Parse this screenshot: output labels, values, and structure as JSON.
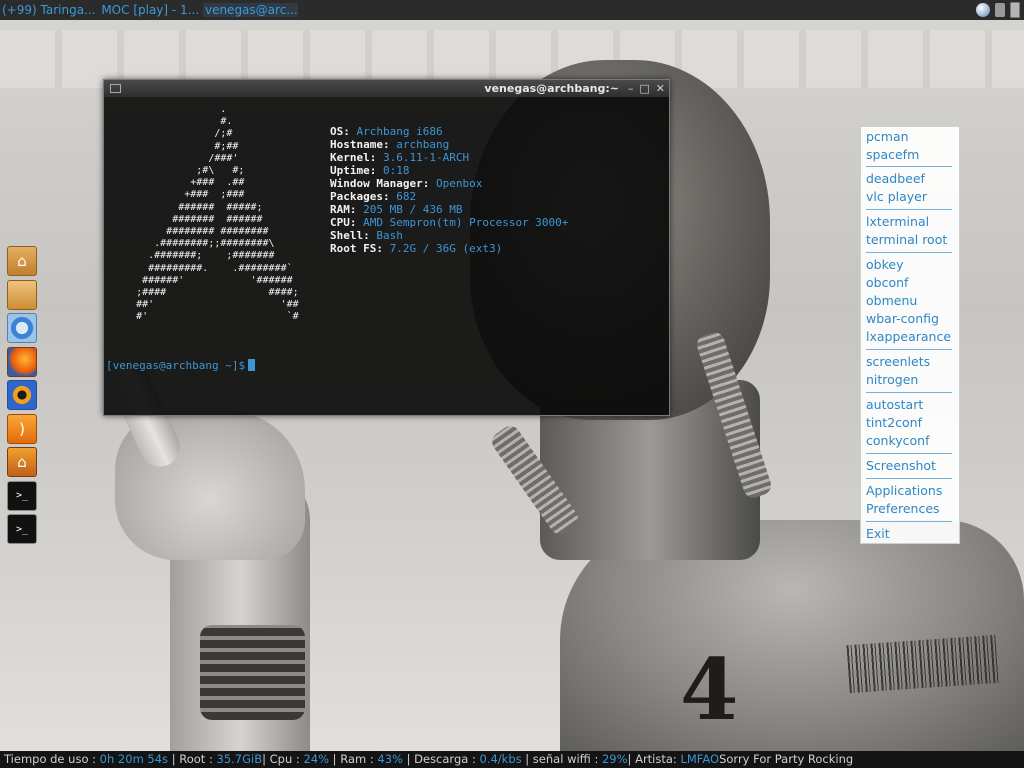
{
  "top_panel": {
    "tasks": [
      "(+99) Taringa...",
      "MOC [play] - 1...",
      "venegas@arc..."
    ]
  },
  "terminal": {
    "title": "venegas@archbang:~",
    "ascii_logo": "                  .\n                  #.\n                 /;#\n                 #;##\n                /###'\n              ;#\\   #;\n             +###  .##\n            +###  ;###\n           ######  #####;\n          #######  ######\n         ######## ########\n       .########;;########\\\n      .#######;    ;#######\n      #########.    .########`\n     ######'           '######\n    ;####                 ####;\n    ##'                     '##\n    #'                       `#",
    "info": [
      {
        "key": "OS:",
        "value": "Archbang i686"
      },
      {
        "key": "Hostname:",
        "value": "archbang"
      },
      {
        "key": "Kernel:",
        "value": "3.6.11-1-ARCH"
      },
      {
        "key": "Uptime:",
        "value": "0:18"
      },
      {
        "key": "Window Manager:",
        "value": "Openbox"
      },
      {
        "key": "Packages:",
        "value": "682"
      },
      {
        "key": "RAM:",
        "value": "205 MB / 436 MB"
      },
      {
        "key": "CPU:",
        "value": "AMD Sempron(tm) Processor 3000+"
      },
      {
        "key": "Shell:",
        "value": "Bash"
      },
      {
        "key": "Root FS:",
        "value": "7.2G / 36G (ext3)"
      }
    ],
    "prompt": "[venegas@archbang ~]$"
  },
  "dock": {
    "icons": [
      "home-icon",
      "folder-icon",
      "chromium-icon",
      "firefox-icon",
      "eye-icon",
      "rss-icon",
      "house-icon",
      "terminal-icon",
      "root-terminal-icon"
    ]
  },
  "menu": {
    "groups": [
      [
        "pcman",
        "spacefm"
      ],
      [
        "deadbeef",
        "vlc player"
      ],
      [
        "lxterminal",
        "terminal root"
      ],
      [
        "obkey",
        "obconf",
        "obmenu",
        "wbar-config",
        "lxappearance"
      ],
      [
        "screenlets",
        "nitrogen"
      ],
      [
        "autostart",
        "tint2conf",
        "conkyconf"
      ],
      [
        "Screenshot"
      ],
      [
        "Applications",
        "Preferences"
      ],
      [
        "Exit"
      ]
    ]
  },
  "statusbar": {
    "uptime_label": "Tiempo de uso :",
    "uptime": "0h 20m 54s",
    "root_label": "| Root :",
    "root": "35.7GiB",
    "cpu_label": "| Cpu :",
    "cpu": "24%",
    "ram_label": "| Ram :",
    "ram": "43%",
    "download_label": "| Descarga :",
    "download": "0.4/kbs",
    "wifi_label": "| señal wiffi :",
    "wifi": "29%",
    "artist_label": "| Artista:",
    "artist": "LMFAO",
    "song": "Sorry For Party Rocking"
  },
  "colors": {
    "accent": "#3c96d3",
    "panel_bg": "#2b2b2b",
    "statusbar_bg": "#141414"
  }
}
